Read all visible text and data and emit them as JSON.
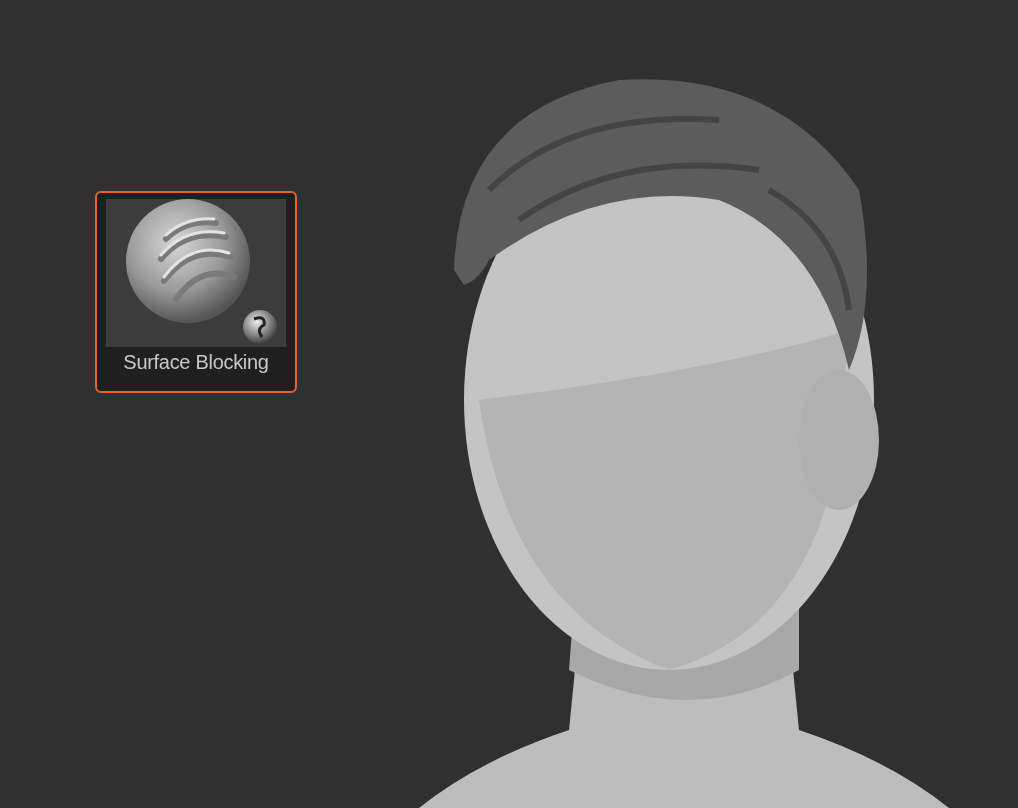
{
  "brush": {
    "label": "Surface Blocking",
    "selected": true
  }
}
